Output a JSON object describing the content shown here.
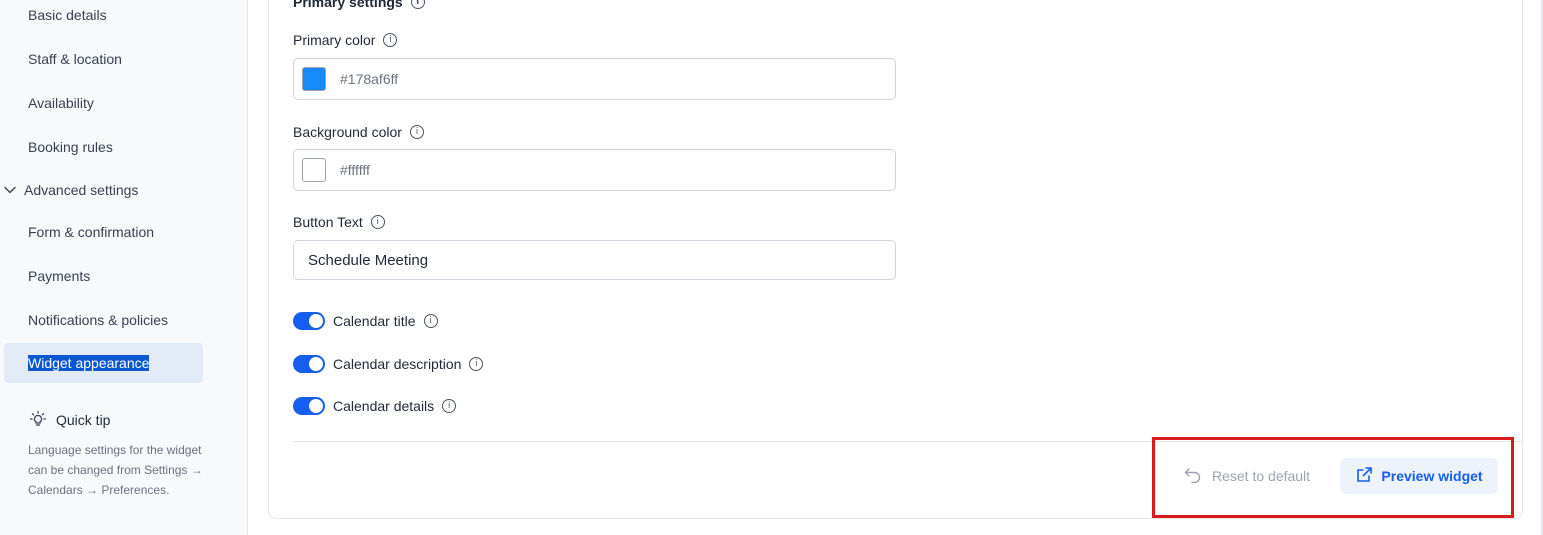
{
  "sidebar": {
    "items": [
      {
        "label": "Basic details"
      },
      {
        "label": "Staff & location"
      },
      {
        "label": "Availability"
      },
      {
        "label": "Booking rules"
      },
      {
        "label": "Form & confirmation"
      },
      {
        "label": "Payments"
      },
      {
        "label": "Notifications & policies"
      },
      {
        "label": "Widget appearance"
      }
    ],
    "group_label": "Advanced settings",
    "active_item": "Widget appearance",
    "quick_tip": {
      "title": "Quick tip",
      "text": "Language settings for the widget can be changed from Settings → Calendars → Preferences."
    }
  },
  "main": {
    "section_title": "Primary settings",
    "primary_color": {
      "label": "Primary color",
      "value": "#178af6ff",
      "swatch": "#178af6"
    },
    "background_color": {
      "label": "Background color",
      "value": "#ffffff",
      "swatch": "#ffffff"
    },
    "button_text": {
      "label": "Button Text",
      "value": "Schedule Meeting"
    },
    "toggles": [
      {
        "label": "Calendar title",
        "on": true
      },
      {
        "label": "Calendar description",
        "on": true
      },
      {
        "label": "Calendar details",
        "on": true
      }
    ],
    "actions": {
      "reset_label": "Reset to default",
      "preview_label": "Preview widget"
    }
  },
  "colors": {
    "accent": "#155eef",
    "highlight_box": "#d81b1b"
  }
}
